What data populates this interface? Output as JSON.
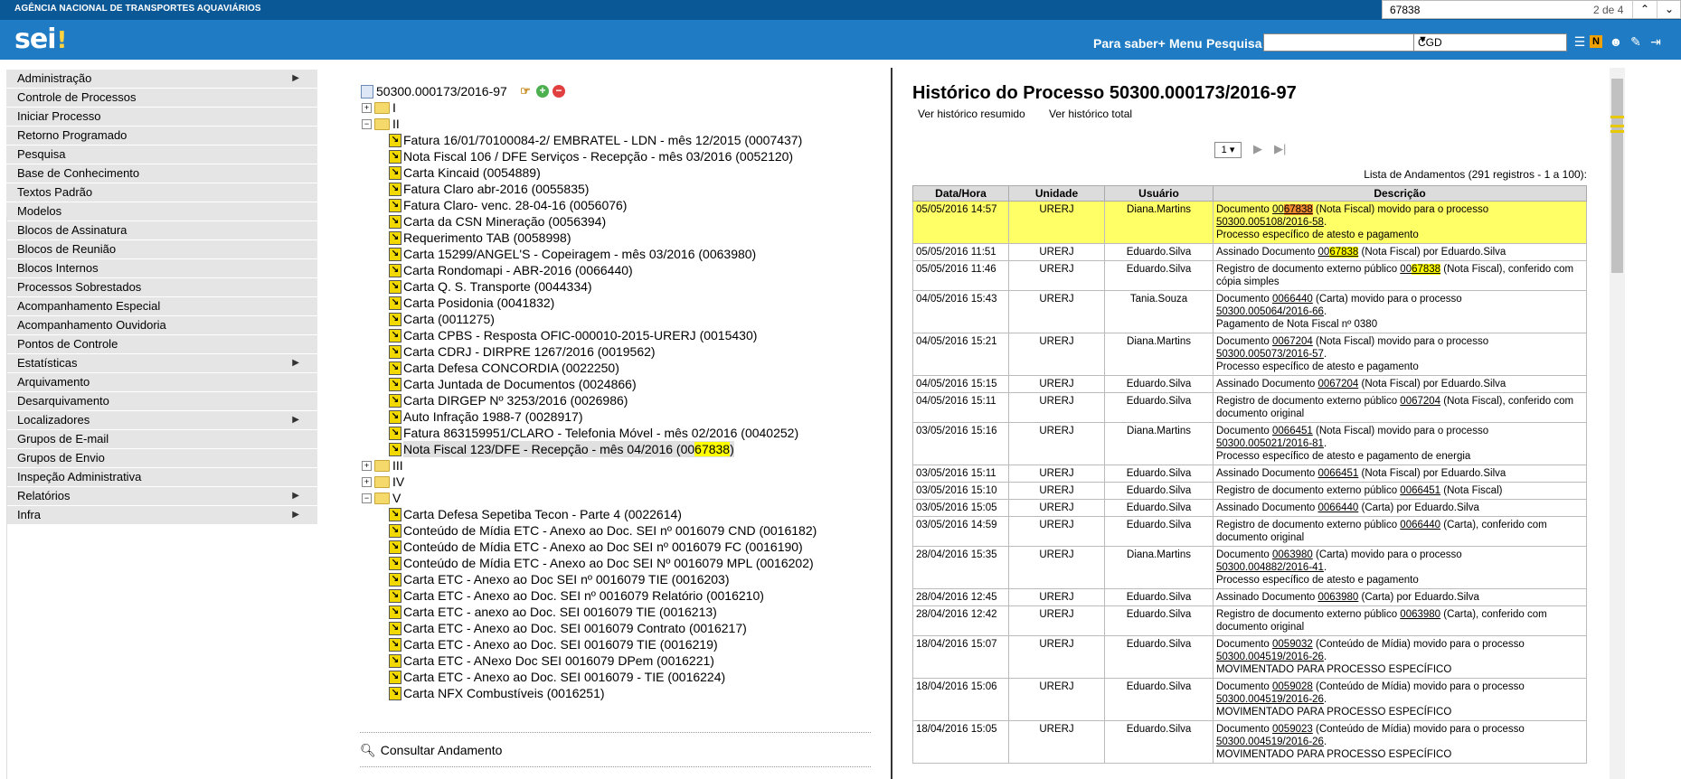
{
  "header": {
    "agency": "AGÊNCIA NACIONAL DE TRANSPORTES AQUAVIÁRIOS",
    "logo": "sei",
    "logo_mark": "!",
    "links": [
      "Para saber+",
      "Menu",
      "Pesquisa"
    ],
    "search_value": "",
    "unit_selected": "CGD",
    "colors": {
      "topbar": "#0b5897",
      "header": "#1f7cc4"
    }
  },
  "findbar": {
    "query": "67838",
    "count": "2 de 4"
  },
  "menu": [
    {
      "label": "Administração",
      "submenu": true
    },
    {
      "label": "Controle de Processos"
    },
    {
      "label": "Iniciar Processo"
    },
    {
      "label": "Retorno Programado"
    },
    {
      "label": "Pesquisa"
    },
    {
      "label": "Base de Conhecimento"
    },
    {
      "label": "Textos Padrão"
    },
    {
      "label": "Modelos"
    },
    {
      "label": "Blocos de Assinatura"
    },
    {
      "label": "Blocos de Reunião"
    },
    {
      "label": "Blocos Internos"
    },
    {
      "label": "Processos Sobrestados"
    },
    {
      "label": "Acompanhamento Especial"
    },
    {
      "label": "Acompanhamento Ouvidoria"
    },
    {
      "label": "Pontos de Controle"
    },
    {
      "label": "Estatísticas",
      "submenu": true
    },
    {
      "label": "Arquivamento"
    },
    {
      "label": "Desarquivamento"
    },
    {
      "label": "Localizadores",
      "submenu": true
    },
    {
      "label": "Grupos de E-mail"
    },
    {
      "label": "Grupos de Envio"
    },
    {
      "label": "Inspeção Administrativa"
    },
    {
      "label": "Relatórios",
      "submenu": true
    },
    {
      "label": "Infra",
      "submenu": true
    }
  ],
  "tree": {
    "process": "50300.000173/2016-97",
    "folders": {
      "I": "I",
      "II": "II",
      "III": "III",
      "IV": "IV",
      "V": "V"
    },
    "docs_II": [
      "Fatura 16/01/70100084-2/ EMBRATEL - LDN - mês 12/2015 (0007437)",
      "Nota Fiscal 106 / DFE Serviços - Recepção - mês 03/2016 (0052120)",
      "Carta Kincaid (0054889)",
      "Fatura Claro abr-2016 (0055835)",
      "Fatura Claro- venc. 28-04-16 (0056076)",
      "Carta da CSN Mineração (0056394)",
      "Requerimento TAB (0058998)",
      "Carta 15299/ANGEL'S - Copeiragem - mês 03/2016 (0063980)",
      "Carta Rondomapi - ABR-2016 (0066440)",
      "Carta Q. S. Transporte (0044334)",
      "Carta Posidonia (0041832)",
      "Carta (0011275)",
      "Carta CPBS - Resposta OFIC-000010-2015-URERJ (0015430)",
      "Carta CDRJ - DIRPRE 1267/2016 (0019562)",
      "Carta Defesa CONCORDIA (0022250)",
      "Carta Juntada de Documentos (0024866)",
      "Carta DIRGEP Nº 3253/2016 (0026986)",
      "Auto Infração 1988-7 (0028917)",
      "Fatura 863159951/CLARO - Telefonia Móvel - mês 02/2016 (0040252)"
    ],
    "selected_doc_prefix": "Nota Fiscal 123/DFE - Recepção - mês 04/2016 (00",
    "selected_doc_match": "67838",
    "selected_doc_suffix": ")",
    "docs_V": [
      "Carta Defesa Sepetiba Tecon - Parte 4 (0022614)",
      "Conteúdo de Mídia ETC - Anexo ao Doc. SEI nº 0016079 CND (0016182)",
      "Conteúdo de Mídia ETC - Anexo ao Doc SEI nº 0016079 FC (0016190)",
      "Conteúdo de Mídia ETC - Anexo ao Doc SEI Nº 0016079 MPL (0016202)",
      "Carta ETC - Anexo ao Doc SEI nº 0016079 TIE (0016203)",
      "Carta ETC - Anexo ao Doc. SEI nº 0016079 Relatório (0016210)",
      "Carta ETC - anexo ao Doc. SEI 0016079 TIE (0016213)",
      "Carta ETC - Anexo ao Doc. SEI 0016079 Contrato (0016217)",
      "Carta ETC - Anexo ao Doc. SEI 0016079 TIE (0016219)",
      "Carta ETC - ANexo Doc SEI 0016079 DPem (0016221)",
      "Carta ETC - Anexo ao Doc. SEI 0016079 - TIE (0016224)",
      "Carta NFX Combustíveis (0016251)"
    ],
    "consult": "Consultar Andamento"
  },
  "history": {
    "title": "Histórico do Processo 50300.000173/2016-97",
    "link_summary": "Ver histórico resumido",
    "link_total": "Ver histórico total",
    "page": "1",
    "caption": "Lista de Andamentos (291 registros - 1 a 100):",
    "columns": [
      "Data/Hora",
      "Unidade",
      "Usuário",
      "Descrição"
    ],
    "rows": [
      {
        "dt": "05/05/2016 14:57",
        "unit": "URERJ",
        "user": "Diana.Martins",
        "d1": "Documento ",
        "doc": "0067838",
        "d2": " (Nota Fiscal) movido para o processo ",
        "proc": "50300.005108/2016-58",
        "d3": ".",
        "note": "Processo específico de atesto e pagamento"
      },
      {
        "dt": "05/05/2016 11:51",
        "unit": "URERJ",
        "user": "Eduardo.Silva",
        "d1": "Assinado Documento ",
        "doc": "0067838",
        "d2": " (Nota Fiscal) por Eduardo.Silva",
        "proc": "",
        "d3": "",
        "note": ""
      },
      {
        "dt": "05/05/2016 11:46",
        "unit": "URERJ",
        "user": "Eduardo.Silva",
        "d1": "Registro de documento externo público ",
        "doc": "0067838",
        "d2": " (Nota Fiscal), conferido com cópia simples",
        "proc": "",
        "d3": "",
        "note": ""
      },
      {
        "dt": "04/05/2016 15:43",
        "unit": "URERJ",
        "user": "Tania.Souza",
        "d1": "Documento ",
        "doc": "0066440",
        "d2": " (Carta) movido para o processo ",
        "proc": "50300.005064/2016-66",
        "d3": ".",
        "note": "Pagamento de Nota Fiscal nº 0380"
      },
      {
        "dt": "04/05/2016 15:21",
        "unit": "URERJ",
        "user": "Diana.Martins",
        "d1": "Documento ",
        "doc": "0067204",
        "d2": " (Nota Fiscal) movido para o processo ",
        "proc": "50300.005073/2016-57",
        "d3": ".",
        "note": "Processo específico de atesto e pagamento"
      },
      {
        "dt": "04/05/2016 15:15",
        "unit": "URERJ",
        "user": "Eduardo.Silva",
        "d1": "Assinado Documento ",
        "doc": "0067204",
        "d2": " (Nota Fiscal) por Eduardo.Silva",
        "proc": "",
        "d3": "",
        "note": ""
      },
      {
        "dt": "04/05/2016 15:11",
        "unit": "URERJ",
        "user": "Eduardo.Silva",
        "d1": "Registro de documento externo público ",
        "doc": "0067204",
        "d2": " (Nota Fiscal), conferido com documento original",
        "proc": "",
        "d3": "",
        "note": ""
      },
      {
        "dt": "03/05/2016 15:16",
        "unit": "URERJ",
        "user": "Diana.Martins",
        "d1": "Documento ",
        "doc": "0066451",
        "d2": " (Nota Fiscal) movido para o processo ",
        "proc": "50300.005021/2016-81",
        "d3": ".",
        "note": "Processo específico de atesto e pagamento de energia"
      },
      {
        "dt": "03/05/2016 15:11",
        "unit": "URERJ",
        "user": "Eduardo.Silva",
        "d1": "Assinado Documento ",
        "doc": "0066451",
        "d2": " (Nota Fiscal) por Eduardo.Silva",
        "proc": "",
        "d3": "",
        "note": ""
      },
      {
        "dt": "03/05/2016 15:10",
        "unit": "URERJ",
        "user": "Eduardo.Silva",
        "d1": "Registro de documento externo público ",
        "doc": "0066451",
        "d2": " (Nota Fiscal)",
        "proc": "",
        "d3": "",
        "note": ""
      },
      {
        "dt": "03/05/2016 15:05",
        "unit": "URERJ",
        "user": "Eduardo.Silva",
        "d1": "Assinado Documento ",
        "doc": "0066440",
        "d2": " (Carta) por Eduardo.Silva",
        "proc": "",
        "d3": "",
        "note": ""
      },
      {
        "dt": "03/05/2016 14:59",
        "unit": "URERJ",
        "user": "Eduardo.Silva",
        "d1": "Registro de documento externo público ",
        "doc": "0066440",
        "d2": " (Carta), conferido com documento original",
        "proc": "",
        "d3": "",
        "note": ""
      },
      {
        "dt": "28/04/2016 15:35",
        "unit": "URERJ",
        "user": "Diana.Martins",
        "d1": "Documento ",
        "doc": "0063980",
        "d2": " (Carta) movido para o processo ",
        "proc": "50300.004882/2016-41",
        "d3": ".",
        "note": "Processo específico de atesto e pagamento"
      },
      {
        "dt": "28/04/2016 12:45",
        "unit": "URERJ",
        "user": "Eduardo.Silva",
        "d1": "Assinado Documento ",
        "doc": "0063980",
        "d2": " (Carta) por Eduardo.Silva",
        "proc": "",
        "d3": "",
        "note": ""
      },
      {
        "dt": "28/04/2016 12:42",
        "unit": "URERJ",
        "user": "Eduardo.Silva",
        "d1": "Registro de documento externo público ",
        "doc": "0063980",
        "d2": " (Carta), conferido com documento original",
        "proc": "",
        "d3": "",
        "note": ""
      },
      {
        "dt": "18/04/2016 15:07",
        "unit": "URERJ",
        "user": "Eduardo.Silva",
        "d1": "Documento ",
        "doc": "0059032",
        "d2": " (Conteúdo de Mídia) movido para o processo ",
        "proc": "50300.004519/2016-26",
        "d3": ".",
        "note": "MOVIMENTADO PARA PROCESSO ESPECÍFICO"
      },
      {
        "dt": "18/04/2016 15:06",
        "unit": "URERJ",
        "user": "Eduardo.Silva",
        "d1": "Documento ",
        "doc": "0059028",
        "d2": " (Conteúdo de Mídia) movido para o processo ",
        "proc": "50300.004519/2016-26",
        "d3": ".",
        "note": "MOVIMENTADO PARA PROCESSO ESPECÍFICO"
      },
      {
        "dt": "18/04/2016 15:05",
        "unit": "URERJ",
        "user": "Eduardo.Silva",
        "d1": "Documento ",
        "doc": "0059023",
        "d2": " (Conteúdo de Mídia) movido para o processo ",
        "proc": "50300.004519/2016-26",
        "d3": ".",
        "note": "MOVIMENTADO PARA PROCESSO ESPECÍFICO"
      }
    ]
  }
}
